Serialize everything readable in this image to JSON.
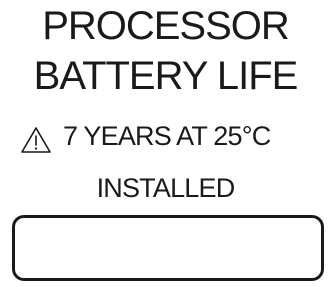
{
  "label": {
    "title_line_1": "PROCESSOR",
    "title_line_2": "BATTERY LIFE",
    "warning_icon": "warning-triangle-icon",
    "warning_text": "7 YEARS AT 25°C",
    "installed_label": "INSTALLED",
    "installed_value": ""
  }
}
